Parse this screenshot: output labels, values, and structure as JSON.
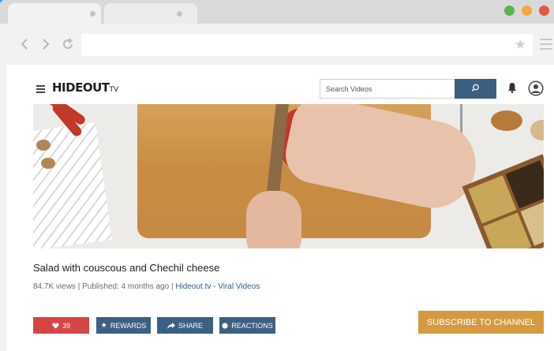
{
  "browser": {
    "window_colors": [
      "#54b84a",
      "#f2a93b",
      "#e55648"
    ],
    "icons": {
      "back": "chevron-left-icon",
      "forward": "chevron-right-icon",
      "reload": "reload-icon",
      "bookmark": "star-icon",
      "menu": "menu-icon"
    },
    "url": ""
  },
  "site": {
    "logo_main": "HIDEOUT",
    "logo_suffix": "TV",
    "search_placeholder": "Search Videos",
    "icons": {
      "menu": "hamburger-icon",
      "search": "search-icon",
      "notifications": "bell-icon",
      "account": "user-icon"
    }
  },
  "video": {
    "title": "Salad with couscous and Chechil cheese",
    "views": "84.7K views",
    "separator": "|",
    "published": "Published: 4 months ago",
    "channel_link": "Hideout.tv - Viral Videos"
  },
  "actions": {
    "like_count": "39",
    "rewards_label": "REWARDS",
    "share_label": "SHARE",
    "reactions_label": "REACTIONS",
    "subscribe_label": "SUBSCRIBE TO CHANNEL"
  },
  "colors": {
    "accent_blue": "#3d5f82",
    "like_red": "#d64545",
    "subscribe_orange": "#d59a3f",
    "background": "#2a9fd6"
  }
}
